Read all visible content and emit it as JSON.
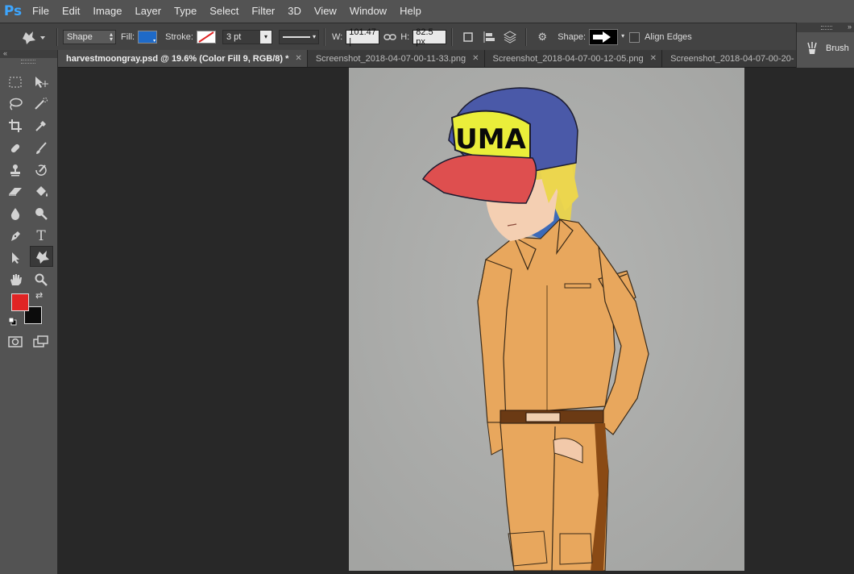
{
  "app": {
    "logo": "Ps"
  },
  "menu": [
    "File",
    "Edit",
    "Image",
    "Layer",
    "Type",
    "Select",
    "Filter",
    "3D",
    "View",
    "Window",
    "Help"
  ],
  "options_bar": {
    "mode": "Shape",
    "fill_label": "Fill:",
    "fill_color": "#1e6ac8",
    "stroke_label": "Stroke:",
    "stroke_width": "3 pt",
    "w_label": "W:",
    "w_value": "101.47 |",
    "h_label": "H:",
    "h_value": "82.5 px",
    "shape_label": "Shape:",
    "align_edges_label": "Align Edges",
    "align_edges_checked": false
  },
  "right_panel": {
    "brush_label": "Brush"
  },
  "tabs": [
    {
      "label": "harvestmoongray.psd @ 19.6% (Color Fill 9, RGB/8) *",
      "active": true
    },
    {
      "label": "Screenshot_2018-04-07-00-11-33.png",
      "active": false
    },
    {
      "label": "Screenshot_2018-04-07-00-12-05.png",
      "active": false
    },
    {
      "label": "Screenshot_2018-04-07-00-20-",
      "active": false
    }
  ],
  "colors": {
    "foreground": "#e02424",
    "background": "#0c0c0c",
    "accent": "#3da6ff"
  },
  "artwork": {
    "cap_text": "UMA"
  },
  "tools": [
    "rectangular-marquee-tool-icon",
    "move-tool-icon",
    "lasso-tool-icon",
    "quick-selection-tool-icon",
    "crop-tool-icon",
    "eyedropper-tool-icon",
    "spot-healing-brush-icon",
    "brush-tool-icon",
    "clone-stamp-tool-icon",
    "history-brush-tool-icon",
    "eraser-tool-icon",
    "paint-bucket-tool-icon",
    "blur-tool-icon",
    "dodge-tool-icon",
    "pen-tool-icon",
    "type-tool-icon",
    "path-selection-tool-icon",
    "custom-shape-tool-icon",
    "hand-tool-icon",
    "zoom-tool-icon"
  ]
}
